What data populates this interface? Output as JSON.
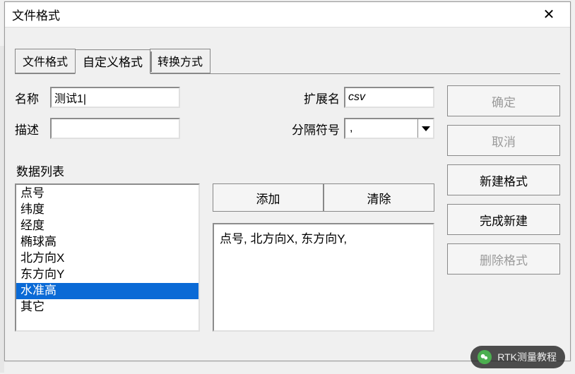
{
  "window": {
    "title": "文件格式",
    "close_symbol": "✕"
  },
  "tabs": {
    "items": [
      {
        "label": "文件格式",
        "active": false
      },
      {
        "label": "自定义格式",
        "active": true
      },
      {
        "label": "转换方式",
        "active": false
      }
    ]
  },
  "form": {
    "name_label": "名称",
    "name_value": "测试1|",
    "desc_label": "描述",
    "desc_value": "",
    "ext_label": "扩展名",
    "ext_value": "csv",
    "sep_label": "分隔符号",
    "sep_value": ","
  },
  "side_buttons": {
    "ok": "确定",
    "cancel": "取消",
    "new_fmt": "新建格式",
    "finish_new": "完成新建",
    "delete_fmt": "删除格式"
  },
  "mid_buttons": {
    "add": "添加",
    "clear": "清除"
  },
  "data_list_label": "数据列表",
  "data_list": {
    "selected_index": 6,
    "items": [
      "点号",
      "纬度",
      "经度",
      "椭球高",
      "北方向X",
      "东方向Y",
      "水准高",
      "其它"
    ]
  },
  "preview_text": "点号, 北方向X, 东方向Y,",
  "watermark": {
    "text": "RTK测量教程"
  }
}
